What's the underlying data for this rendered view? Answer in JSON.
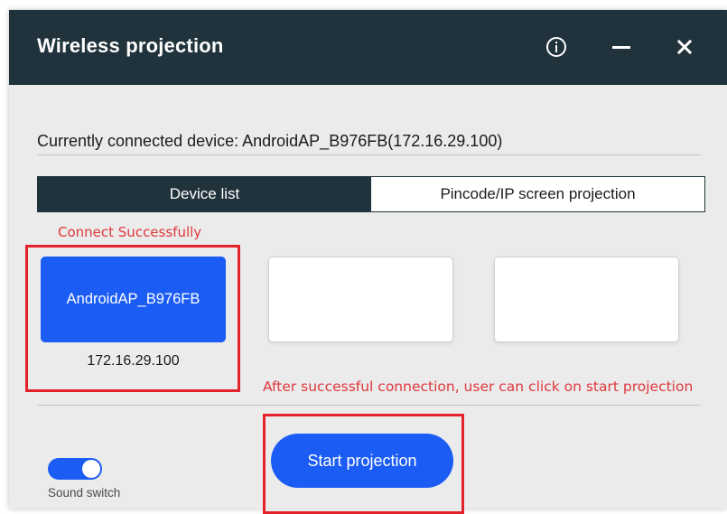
{
  "window": {
    "title": "Wireless projection"
  },
  "titlebar_icons": {
    "info": "info-icon",
    "minimize": "minimize-icon",
    "close": "close-icon"
  },
  "device_status": {
    "text": "Currently connected device: AndroidAP_B976FB(172.16.29.100)"
  },
  "tabs": [
    {
      "label": "Device list",
      "active": true
    },
    {
      "label": "Pincode/IP screen projection",
      "active": false
    }
  ],
  "annotations": {
    "connect_success": "Connect Successfully",
    "after_connection": "After successful connection, user can click on start projection"
  },
  "devices": [
    {
      "name": "AndroidAP_B976FB",
      "ip": "172.16.29.100",
      "selected": true
    },
    {
      "name": "",
      "ip": ""
    },
    {
      "name": "",
      "ip": ""
    }
  ],
  "actions": {
    "start_label": "Start projection"
  },
  "sound": {
    "label": "Sound switch",
    "enabled": true
  },
  "colors": {
    "titlebar": "#20323b",
    "accent": "#1a5cf4",
    "background": "#ebebeb",
    "annotation": "#e0373c",
    "highlight_box": "#e4222b"
  }
}
